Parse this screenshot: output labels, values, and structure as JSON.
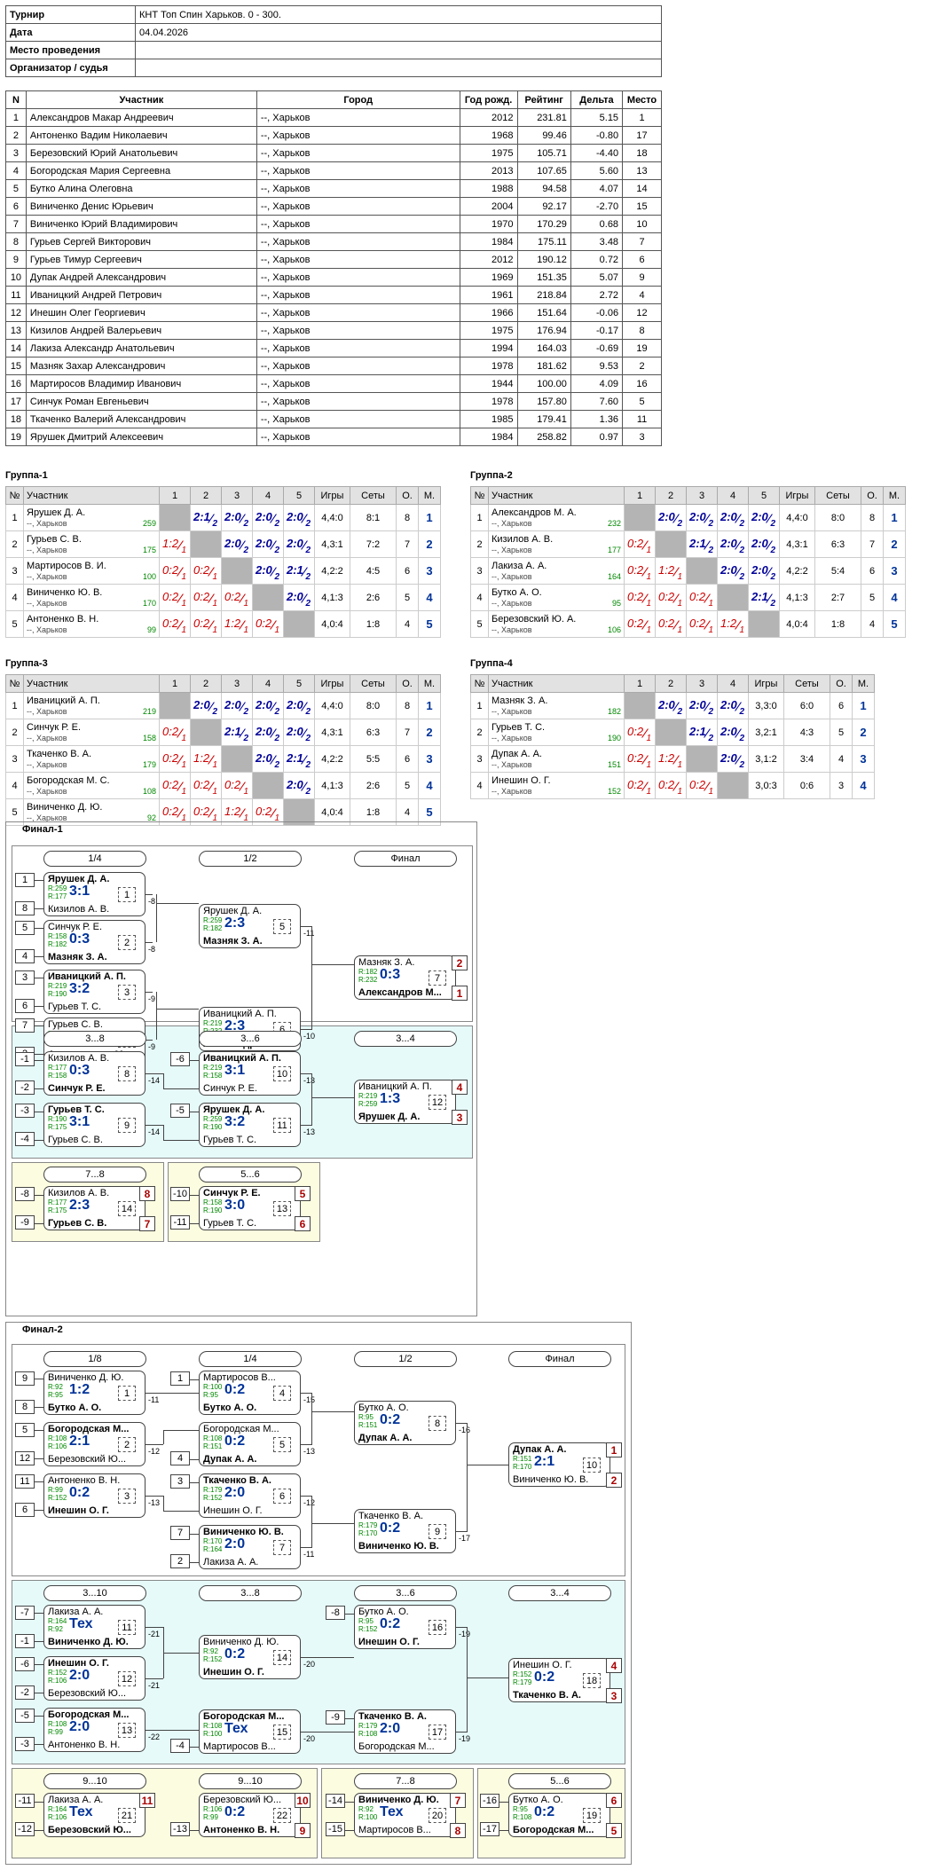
{
  "info": [
    [
      "Турнир",
      "КНТ Топ Спин Харьков. 0 - 300."
    ],
    [
      "Дата",
      "04.04.2026"
    ],
    [
      "Место проведения",
      ""
    ],
    [
      "Организатор / судья",
      ""
    ]
  ],
  "plist_headers": [
    "N",
    "Участник",
    "Город",
    "Год рожд.",
    "Рейтинг",
    "Дельта",
    "Место"
  ],
  "players": [
    [
      "1",
      "Александров Макар Андреевич",
      "--, Харьков",
      "2012",
      "231.81",
      "5.15",
      "1"
    ],
    [
      "2",
      "Антоненко Вадим Николаевич",
      "--, Харьков",
      "1968",
      "99.46",
      "-0.80",
      "17"
    ],
    [
      "3",
      "Березовский Юрий Анатольевич",
      "--, Харьков",
      "1975",
      "105.71",
      "-4.40",
      "18"
    ],
    [
      "4",
      "Богородская Мария Сергеевна",
      "--, Харьков",
      "2013",
      "107.65",
      "5.60",
      "13"
    ],
    [
      "5",
      "Бутко Алина Олеговна",
      "--, Харьков",
      "1988",
      "94.58",
      "4.07",
      "14"
    ],
    [
      "6",
      "Виниченко Денис Юрьевич",
      "--, Харьков",
      "2004",
      "92.17",
      "-2.70",
      "15"
    ],
    [
      "7",
      "Виниченко Юрий Владимирович",
      "--, Харьков",
      "1970",
      "170.29",
      "0.68",
      "10"
    ],
    [
      "8",
      "Гурьев Сергей Викторович",
      "--, Харьков",
      "1984",
      "175.11",
      "3.48",
      "7"
    ],
    [
      "9",
      "Гурьев Тимур Сергеевич",
      "--, Харьков",
      "2012",
      "190.12",
      "0.72",
      "6"
    ],
    [
      "10",
      "Дупак Андрей Александрович",
      "--, Харьков",
      "1969",
      "151.35",
      "5.07",
      "9"
    ],
    [
      "11",
      "Иваницкий Андрей Петрович",
      "--, Харьков",
      "1961",
      "218.84",
      "2.72",
      "4"
    ],
    [
      "12",
      "Инешин Олег Георгиевич",
      "--, Харьков",
      "1966",
      "151.64",
      "-0.06",
      "12"
    ],
    [
      "13",
      "Кизилов Андрей Валерьевич",
      "--, Харьков",
      "1975",
      "176.94",
      "-0.17",
      "8"
    ],
    [
      "14",
      "Лакиза Александр Анатольевич",
      "--, Харьков",
      "1994",
      "164.03",
      "-0.69",
      "19"
    ],
    [
      "15",
      "Мазняк Захар Александрович",
      "--, Харьков",
      "1978",
      "181.62",
      "9.53",
      "2"
    ],
    [
      "16",
      "Мартиросов Владимир Иванович",
      "--, Харьков",
      "1944",
      "100.00",
      "4.09",
      "16"
    ],
    [
      "17",
      "Синчук Роман Евгеньевич",
      "--, Харьков",
      "1978",
      "157.80",
      "7.60",
      "5"
    ],
    [
      "18",
      "Ткаченко Валерий Александрович",
      "--, Харьков",
      "1985",
      "179.41",
      "1.36",
      "11"
    ],
    [
      "19",
      "Ярушек Дмитрий Алексеевич",
      "--, Харьков",
      "1984",
      "258.82",
      "0.97",
      "3"
    ]
  ],
  "group_headers": [
    "№",
    "Участник",
    "Игры",
    "Сеты",
    "О.",
    "М."
  ],
  "groups": [
    {
      "title": "Группа-1",
      "n": 5,
      "rows": [
        {
          "name": "Ярушек Д. А.",
          "city": "--, Харьков",
          "rating": "259",
          "res": [
            "",
            "2:1/2",
            "2:0/2",
            "2:0/2",
            "2:0/2"
          ],
          "games": "4,4:0",
          "sets": "8:1",
          "pts": "8",
          "place": "1"
        },
        {
          "name": "Гурьев С. В.",
          "city": "--, Харьков",
          "rating": "175",
          "res": [
            "1:2/1",
            "",
            "2:0/2",
            "2:0/2",
            "2:0/2"
          ],
          "games": "4,3:1",
          "sets": "7:2",
          "pts": "7",
          "place": "2"
        },
        {
          "name": "Мартиросов В. И.",
          "city": "--, Харьков",
          "rating": "100",
          "res": [
            "0:2/1",
            "0:2/1",
            "",
            "2:0/2",
            "2:1/2"
          ],
          "games": "4,2:2",
          "sets": "4:5",
          "pts": "6",
          "place": "3"
        },
        {
          "name": "Виниченко Ю. В.",
          "city": "--, Харьков",
          "rating": "170",
          "res": [
            "0:2/1",
            "0:2/1",
            "0:2/1",
            "",
            "2:0/2"
          ],
          "games": "4,1:3",
          "sets": "2:6",
          "pts": "5",
          "place": "4"
        },
        {
          "name": "Антоненко В. Н.",
          "city": "--, Харьков",
          "rating": "99",
          "res": [
            "0:2/1",
            "0:2/1",
            "1:2/1",
            "0:2/1",
            ""
          ],
          "games": "4,0:4",
          "sets": "1:8",
          "pts": "4",
          "place": "5"
        }
      ]
    },
    {
      "title": "Группа-2",
      "n": 5,
      "rows": [
        {
          "name": "Александров М. А.",
          "city": "--, Харьков",
          "rating": "232",
          "res": [
            "",
            "2:0/2",
            "2:0/2",
            "2:0/2",
            "2:0/2"
          ],
          "games": "4,4:0",
          "sets": "8:0",
          "pts": "8",
          "place": "1"
        },
        {
          "name": "Кизилов А. В.",
          "city": "--, Харьков",
          "rating": "177",
          "res": [
            "0:2/1",
            "",
            "2:1/2",
            "2:0/2",
            "2:0/2"
          ],
          "games": "4,3:1",
          "sets": "6:3",
          "pts": "7",
          "place": "2"
        },
        {
          "name": "Лакиза А. А.",
          "city": "--, Харьков",
          "rating": "164",
          "res": [
            "0:2/1",
            "1:2/1",
            "",
            "2:0/2",
            "2:0/2"
          ],
          "games": "4,2:2",
          "sets": "5:4",
          "pts": "6",
          "place": "3"
        },
        {
          "name": "Бутко А. О.",
          "city": "--, Харьков",
          "rating": "95",
          "res": [
            "0:2/1",
            "0:2/1",
            "0:2/1",
            "",
            "2:1/2"
          ],
          "games": "4,1:3",
          "sets": "2:7",
          "pts": "5",
          "place": "4"
        },
        {
          "name": "Березовский Ю. А.",
          "city": "--, Харьков",
          "rating": "106",
          "res": [
            "0:2/1",
            "0:2/1",
            "0:2/1",
            "1:2/1",
            ""
          ],
          "games": "4,0:4",
          "sets": "1:8",
          "pts": "4",
          "place": "5"
        }
      ]
    },
    {
      "title": "Группа-3",
      "n": 5,
      "rows": [
        {
          "name": "Иваницкий А. П.",
          "city": "--, Харьков",
          "rating": "219",
          "res": [
            "",
            "2:0/2",
            "2:0/2",
            "2:0/2",
            "2:0/2"
          ],
          "games": "4,4:0",
          "sets": "8:0",
          "pts": "8",
          "place": "1"
        },
        {
          "name": "Синчук Р. Е.",
          "city": "--, Харьков",
          "rating": "158",
          "res": [
            "0:2/1",
            "",
            "2:1/2",
            "2:0/2",
            "2:0/2"
          ],
          "games": "4,3:1",
          "sets": "6:3",
          "pts": "7",
          "place": "2"
        },
        {
          "name": "Ткаченко В. А.",
          "city": "--, Харьков",
          "rating": "179",
          "res": [
            "0:2/1",
            "1:2/1",
            "",
            "2:0/2",
            "2:1/2"
          ],
          "games": "4,2:2",
          "sets": "5:5",
          "pts": "6",
          "place": "3"
        },
        {
          "name": "Богородская М. С.",
          "city": "--, Харьков",
          "rating": "108",
          "res": [
            "0:2/1",
            "0:2/1",
            "0:2/1",
            "",
            "2:0/2"
          ],
          "games": "4,1:3",
          "sets": "2:6",
          "pts": "5",
          "place": "4"
        },
        {
          "name": "Виниченко Д. Ю.",
          "city": "--, Харьков",
          "rating": "92",
          "res": [
            "0:2/1",
            "0:2/1",
            "1:2/1",
            "0:2/1",
            ""
          ],
          "games": "4,0:4",
          "sets": "1:8",
          "pts": "4",
          "place": "5"
        }
      ]
    },
    {
      "title": "Группа-4",
      "n": 4,
      "rows": [
        {
          "name": "Мазняк З. А.",
          "city": "--, Харьков",
          "rating": "182",
          "res": [
            "",
            "2:0/2",
            "2:0/2",
            "2:0/2"
          ],
          "games": "3,3:0",
          "sets": "6:0",
          "pts": "6",
          "place": "1"
        },
        {
          "name": "Гурьев Т. С.",
          "city": "--, Харьков",
          "rating": "190",
          "res": [
            "0:2/1",
            "",
            "2:1/2",
            "2:0/2"
          ],
          "games": "3,2:1",
          "sets": "4:3",
          "pts": "5",
          "place": "2"
        },
        {
          "name": "Дупак А. А.",
          "city": "--, Харьков",
          "rating": "151",
          "res": [
            "0:2/1",
            "1:2/1",
            "",
            "2:0/2"
          ],
          "games": "3,1:2",
          "sets": "3:4",
          "pts": "4",
          "place": "3"
        },
        {
          "name": "Инешин О. Г.",
          "city": "--, Харьков",
          "rating": "152",
          "res": [
            "0:2/1",
            "0:2/1",
            "0:2/1",
            ""
          ],
          "games": "3,0:3",
          "sets": "0:6",
          "pts": "3",
          "place": "4"
        }
      ]
    }
  ],
  "final1": {
    "title": "Финал-1",
    "rounds": [
      "1/4",
      "1/2",
      "Финал",
      "3...8",
      "3...6",
      "3...4",
      "7...8",
      "5...6"
    ],
    "matches": [
      {
        "p1": "Ярушек Д. А.",
        "r1": "R:259",
        "p2": "Кизилов А. В.",
        "r2": "R:177",
        "score": "3:1",
        "w": 1,
        "num": "1"
      },
      {
        "p1": "Синчук Р. Е.",
        "r1": "R:158",
        "p2": "Мазняк З. А.",
        "r2": "R:182",
        "score": "0:3",
        "w": 2,
        "num": "2"
      },
      {
        "p1": "Иваницкий А. П.",
        "r1": "R:219",
        "p2": "Гурьев Т. С.",
        "r2": "R:190",
        "score": "3:2",
        "w": 1,
        "num": "3"
      },
      {
        "p1": "Гурьев С. В.",
        "r1": "R:175",
        "p2": "Александров М...",
        "r2": "R:232",
        "score": "2:3",
        "w": 2,
        "num": "4"
      },
      {
        "p1": "Ярушек Д. А.",
        "r1": "R:259",
        "p2": "Мазняк З. А.",
        "r2": "R:182",
        "score": "2:3",
        "w": 2,
        "num": "5"
      },
      {
        "p1": "Иваницкий А. П.",
        "r1": "R:219",
        "p2": "Александров М...",
        "r2": "R:232",
        "score": "2:3",
        "w": 2,
        "num": "6"
      },
      {
        "p1": "Мазняк З. А.",
        "r1": "R:182",
        "p2": "Александров М...",
        "r2": "R:232",
        "score": "0:3",
        "w": 2,
        "num": "7"
      },
      {
        "p1": "Кизилов А. В.",
        "r1": "R:177",
        "p2": "Синчук Р. Е.",
        "r2": "R:158",
        "score": "0:3",
        "w": 2,
        "num": "8"
      },
      {
        "p1": "Гурьев Т. С.",
        "r1": "R:190",
        "p2": "Гурьев С. В.",
        "r2": "R:175",
        "score": "3:1",
        "w": 1,
        "num": "9"
      },
      {
        "p1": "Иваницкий А. П.",
        "r1": "R:219",
        "p2": "Синчук Р. Е.",
        "r2": "R:158",
        "score": "3:1",
        "w": 1,
        "num": "10"
      },
      {
        "p1": "Ярушек Д. А.",
        "r1": "R:259",
        "p2": "Гурьев Т. С.",
        "r2": "R:190",
        "score": "3:2",
        "w": 1,
        "num": "11"
      },
      {
        "p1": "Иваницкий А. П.",
        "r1": "R:219",
        "p2": "Ярушек Д. А.",
        "r2": "R:259",
        "score": "1:3",
        "w": 2,
        "num": "12"
      },
      {
        "p1": "Кизилов А. В.",
        "r1": "R:177",
        "p2": "Гурьев С. В.",
        "r2": "R:175",
        "score": "2:3",
        "w": 2,
        "num": "14"
      },
      {
        "p1": "Синчук Р. Е.",
        "r1": "R:158",
        "p2": "Гурьев Т. С.",
        "r2": "R:190",
        "score": "3:0",
        "w": 1,
        "num": "13"
      }
    ],
    "seeds": [
      "1",
      "8",
      "5",
      "4",
      "3",
      "6",
      "7",
      "2",
      "-1",
      "-2",
      "-3",
      "-4",
      "-6",
      "-5",
      "-8",
      "-9",
      "-10",
      "-11"
    ],
    "losers": [
      "-8",
      "-8",
      "-9",
      "-9",
      "-11",
      "-10",
      "-14",
      "-14",
      "-13",
      "-13"
    ],
    "places": [
      "2",
      "1",
      "4",
      "3",
      "8",
      "7",
      "5",
      "6"
    ]
  },
  "final2": {
    "title": "Финал-2",
    "rounds": [
      "1/8",
      "1/4",
      "1/2",
      "Финал",
      "3...10",
      "3...8",
      "3...6",
      "3...4",
      "9...10",
      "9...10",
      "7...8",
      "5...6"
    ],
    "matches": [
      {
        "p1": "Виниченко Д. Ю.",
        "r1": "R:92",
        "p2": "Бутко А. О.",
        "r2": "R:95",
        "score": "1:2",
        "w": 2,
        "num": "1"
      },
      {
        "p1": "Богородская М...",
        "r1": "R:108",
        "p2": "Березовский Ю...",
        "r2": "R:106",
        "score": "2:1",
        "w": 1,
        "num": "2"
      },
      {
        "p1": "Антоненко В. Н.",
        "r1": "R:99",
        "p2": "Инешин О. Г.",
        "r2": "R:152",
        "score": "0:2",
        "w": 2,
        "num": "3"
      },
      {
        "p1": "Мартиросов В...",
        "r1": "R:100",
        "p2": "Бутко А. О.",
        "r2": "R:95",
        "score": "0:2",
        "w": 2,
        "num": "4"
      },
      {
        "p1": "Богородская М...",
        "r1": "R:108",
        "p2": "Дупак А. А.",
        "r2": "R:151",
        "score": "0:2",
        "w": 2,
        "num": "5"
      },
      {
        "p1": "Ткаченко В. А.",
        "r1": "R:179",
        "p2": "Инешин О. Г.",
        "r2": "R:152",
        "score": "2:0",
        "w": 1,
        "num": "6"
      },
      {
        "p1": "Виниченко Ю. В.",
        "r1": "R:170",
        "p2": "Лакиза А. А.",
        "r2": "R:164",
        "score": "2:0",
        "w": 1,
        "num": "7"
      },
      {
        "p1": "Бутко А. О.",
        "r1": "R:95",
        "p2": "Дупак А. А.",
        "r2": "R:151",
        "score": "0:2",
        "w": 2,
        "num": "8"
      },
      {
        "p1": "Ткаченко В. А.",
        "r1": "R:179",
        "p2": "Виниченко Ю. В.",
        "r2": "R:170",
        "score": "0:2",
        "w": 2,
        "num": "9"
      },
      {
        "p1": "Дупак А. А.",
        "r1": "R:151",
        "p2": "Виниченко Ю. В.",
        "r2": "R:170",
        "score": "2:1",
        "w": 1,
        "num": "10"
      },
      {
        "p1": "Лакиза А. А.",
        "r1": "R:164",
        "p2": "Виниченко Д. Ю.",
        "r2": "R:92",
        "score": "Тех",
        "w": 2,
        "num": "11"
      },
      {
        "p1": "Инешин О. Г.",
        "r1": "R:152",
        "p2": "Березовский Ю...",
        "r2": "R:106",
        "score": "2:0",
        "w": 1,
        "num": "12"
      },
      {
        "p1": "Богородская М...",
        "r1": "R:108",
        "p2": "Антоненко В. Н.",
        "r2": "R:99",
        "score": "2:0",
        "w": 1,
        "num": "13"
      },
      {
        "p1": "Виниченко Д. Ю.",
        "r1": "R:92",
        "p2": "Инешин О. Г.",
        "r2": "R:152",
        "score": "0:2",
        "w": 2,
        "num": "14"
      },
      {
        "p1": "Богородская М...",
        "r1": "R:108",
        "p2": "Мартиросов В...",
        "r2": "R:100",
        "score": "Тех",
        "w": 1,
        "num": "15"
      },
      {
        "p1": "Бутко А. О.",
        "r1": "R:95",
        "p2": "Инешин О. Г.",
        "r2": "R:152",
        "score": "0:2",
        "w": 2,
        "num": "16"
      },
      {
        "p1": "Ткаченко В. А.",
        "r1": "R:179",
        "p2": "Богородская М...",
        "r2": "R:108",
        "score": "2:0",
        "w": 1,
        "num": "17"
      },
      {
        "p1": "Инешин О. Г.",
        "r1": "R:152",
        "p2": "Ткаченко В. А.",
        "r2": "R:179",
        "score": "0:2",
        "w": 2,
        "num": "18"
      },
      {
        "p1": "Лакиза А. А.",
        "r1": "R:164",
        "p2": "Березовский Ю...",
        "r2": "R:106",
        "score": "Тех",
        "w": 2,
        "num": "21"
      },
      {
        "p1": "Березовский Ю...",
        "r1": "R:106",
        "p2": "Антоненко В. Н.",
        "r2": "R:99",
        "score": "0:2",
        "w": 2,
        "num": "22"
      },
      {
        "p1": "Виниченко Д. Ю.",
        "r1": "R:92",
        "p2": "Мартиросов В...",
        "r2": "R:100",
        "score": "Тех",
        "w": 1,
        "num": "20"
      },
      {
        "p1": "Бутко А. О.",
        "r1": "R:95",
        "p2": "Богородская М...",
        "r2": "R:108",
        "score": "0:2",
        "w": 2,
        "num": "19"
      }
    ],
    "seeds": [
      "9",
      "8",
      "5",
      "12",
      "11",
      "6",
      "1",
      "4",
      "3",
      "7",
      "2",
      "-7",
      "-1",
      "-6",
      "-2",
      "-5",
      "-3",
      "-4",
      "-8",
      "-9",
      "-11",
      "-12",
      "-13",
      "-14",
      "-15",
      "-16",
      "-17"
    ],
    "losers": [
      "-11",
      "-12",
      "-13",
      "-15",
      "-13",
      "-12",
      "-11",
      "-16",
      "-17",
      "-21",
      "-21",
      "-22",
      "-20",
      "-20",
      "-19",
      "-19"
    ],
    "places": [
      "1",
      "2",
      "4",
      "3",
      "11",
      "10",
      "9",
      "7",
      "8",
      "6",
      "5"
    ]
  }
}
